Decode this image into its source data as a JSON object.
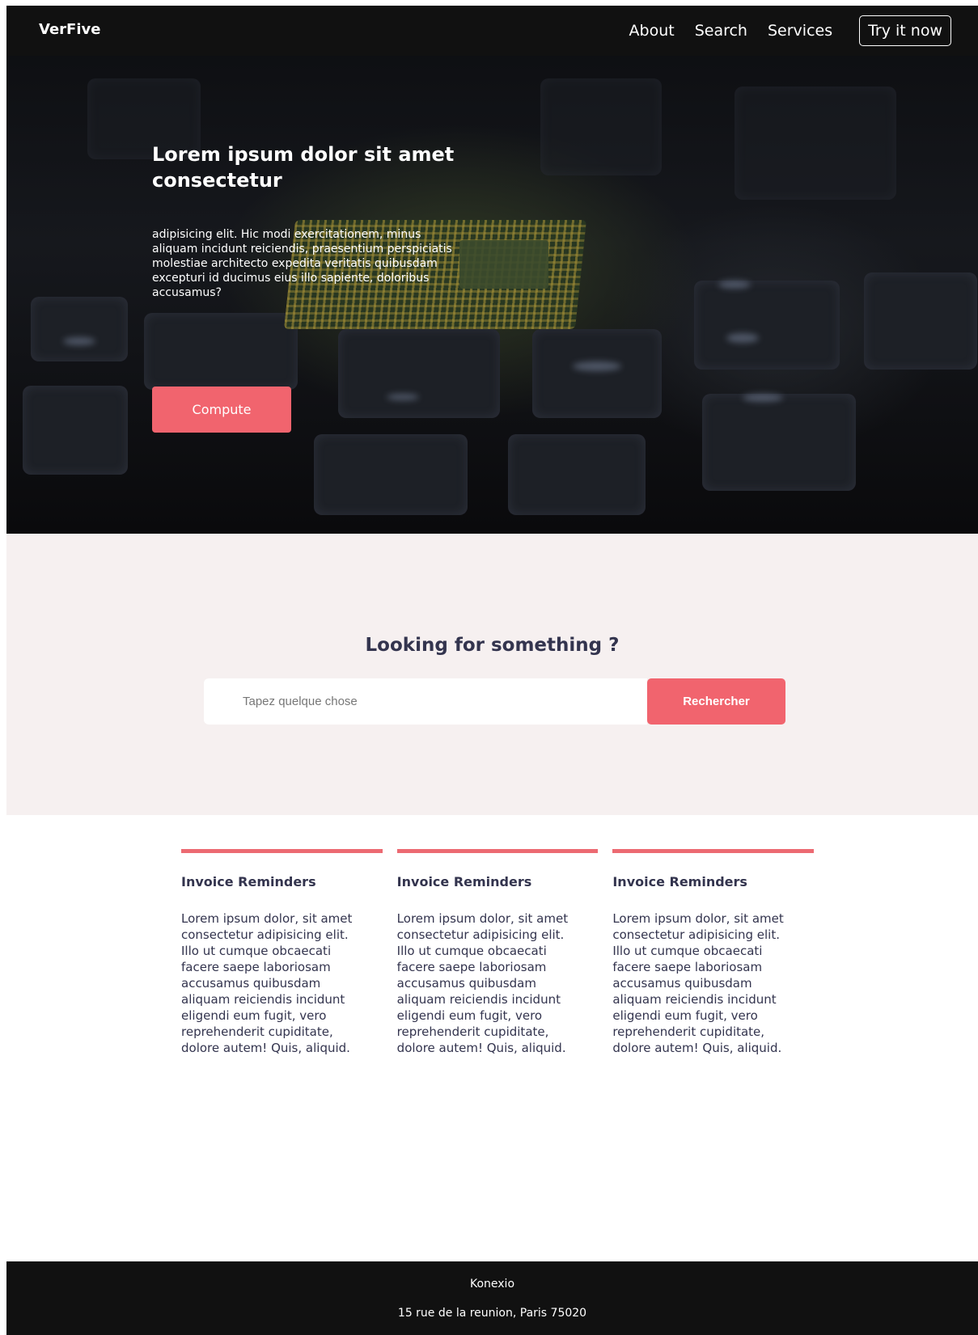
{
  "nav": {
    "logo": "VerFive",
    "links": [
      "About",
      "Search",
      "Services"
    ],
    "cta": "Try it now"
  },
  "hero": {
    "title": "Lorem ipsum dolor sit amet consectetur",
    "text": "adipisicing elit. Hic modi exercitationem, minus aliquam incidunt reiciendis, praesentium perspiciatis molestiae architecto expedita veritatis quibusdam excepturi id ducimus eius illo sapiente, doloribus accusamus?",
    "button": "Compute"
  },
  "search": {
    "title": "Looking for something ?",
    "placeholder": "Tapez quelque chose",
    "value": "",
    "button": "Rechercher"
  },
  "features": [
    {
      "title": "Invoice Reminders",
      "text": "Lorem ipsum dolor, sit amet consectetur adipisicing elit. Illo ut cumque obcaecati facere saepe laboriosam accusamus quibusdam aliquam reiciendis incidunt eligendi eum fugit, vero reprehenderit cupiditate, dolore autem! Quis, aliquid."
    },
    {
      "title": "Invoice Reminders",
      "text": "Lorem ipsum dolor, sit amet consectetur adipisicing elit. Illo ut cumque obcaecati facere saepe laboriosam accusamus quibusdam aliquam reiciendis incidunt eligendi eum fugit, vero reprehenderit cupiditate, dolore autem! Quis, aliquid."
    },
    {
      "title": "Invoice Reminders",
      "text": "Lorem ipsum dolor, sit amet consectetur adipisicing elit. Illo ut cumque obcaecati facere saepe laboriosam accusamus quibusdam aliquam reiciendis incidunt eligendi eum fugit, vero reprehenderit cupiditate, dolore autem! Quis, aliquid."
    }
  ],
  "footer": {
    "company": "Konexio",
    "address": "15 rue de la reunion, Paris 75020"
  },
  "colors": {
    "accent": "#f1646e",
    "dark": "#111111",
    "heading": "#33344e",
    "section_bg": "#f6f0f0"
  }
}
